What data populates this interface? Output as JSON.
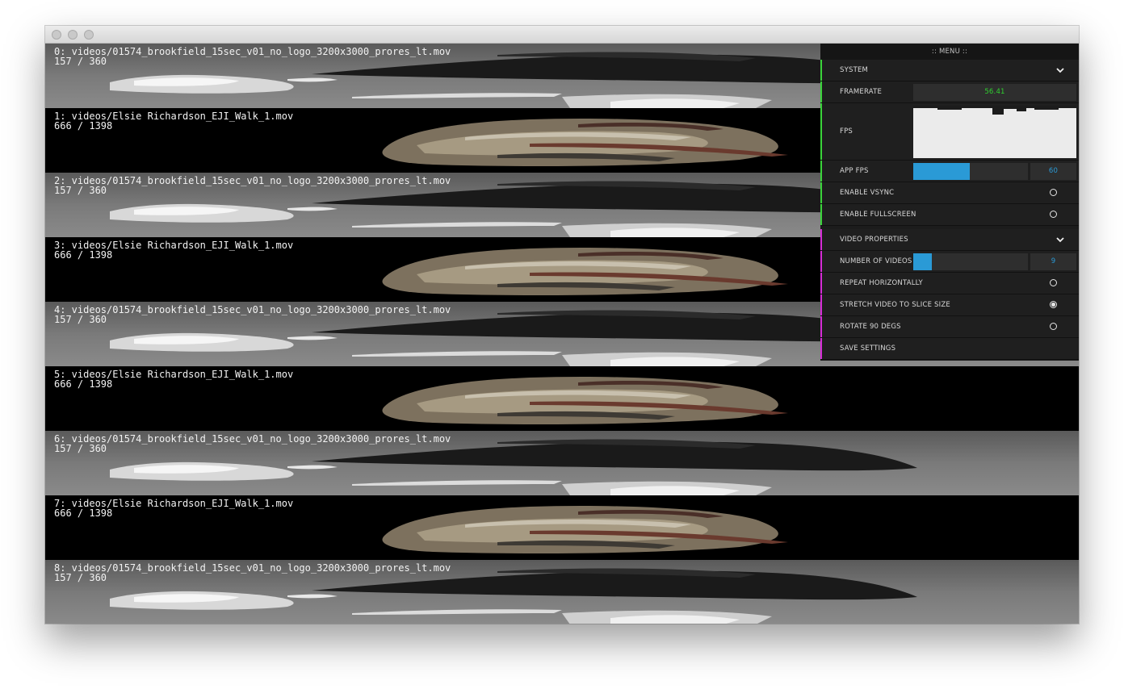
{
  "window": {
    "controls": [
      "close-button",
      "minimize-button",
      "zoom-button"
    ]
  },
  "slices": [
    {
      "label": "0: videos/01574_brookfield_15sec_v01_no_logo_3200x3000_prores_lt.mov",
      "frame": "157 / 360",
      "style": "gray"
    },
    {
      "label": "1: videos/Elsie Richardson_EJI_Walk_1.mov",
      "frame": "666 / 1398",
      "style": "black"
    },
    {
      "label": "2: videos/01574_brookfield_15sec_v01_no_logo_3200x3000_prores_lt.mov",
      "frame": "157 / 360",
      "style": "gray"
    },
    {
      "label": "3: videos/Elsie Richardson_EJI_Walk_1.mov",
      "frame": "666 / 1398",
      "style": "black"
    },
    {
      "label": "4: videos/01574_brookfield_15sec_v01_no_logo_3200x3000_prores_lt.mov",
      "frame": "157 / 360",
      "style": "gray"
    },
    {
      "label": "5: videos/Elsie Richardson_EJI_Walk_1.mov",
      "frame": "666 / 1398",
      "style": "black"
    },
    {
      "label": "6: videos/01574_brookfield_15sec_v01_no_logo_3200x3000_prores_lt.mov",
      "frame": "157 / 360",
      "style": "gray"
    },
    {
      "label": "7: videos/Elsie Richardson_EJI_Walk_1.mov",
      "frame": "666 / 1398",
      "style": "black"
    },
    {
      "label": "8: videos/01574_brookfield_15sec_v01_no_logo_3200x3000_prores_lt.mov",
      "frame": "157 / 360",
      "style": "gray"
    }
  ],
  "menu": {
    "title": ":: MENU ::",
    "system": {
      "header": "SYSTEM",
      "accent": "#3ad33a",
      "framerate_label": "FRAMERATE",
      "framerate_value": "56.41",
      "framerate_color": "#2fd12f",
      "fps_label": "FPS",
      "app_fps_label": "APP FPS",
      "app_fps_value": "60",
      "app_fps_fraction": 0.49,
      "vsync_label": "ENABLE VSYNC",
      "vsync_on": false,
      "fullscreen_label": "ENABLE FULLSCREEN",
      "fullscreen_on": false
    },
    "video": {
      "header": "VIDEO PROPERTIES",
      "accent": "#d62cd6",
      "num_videos_label": "NUMBER OF VIDEOS",
      "num_videos_value": "9",
      "num_videos_fraction": 0.16,
      "repeat_label": "REPEAT HORIZONTALLY",
      "repeat_on": false,
      "stretch_label": "STRETCH VIDEO TO SLICE SIZE",
      "stretch_on": true,
      "rotate_label": "ROTATE 90 DEGS",
      "rotate_on": false,
      "save_label": "SAVE SETTINGS"
    },
    "value_color": "#2a9ad6",
    "fill_color": "#2a9ad6"
  }
}
